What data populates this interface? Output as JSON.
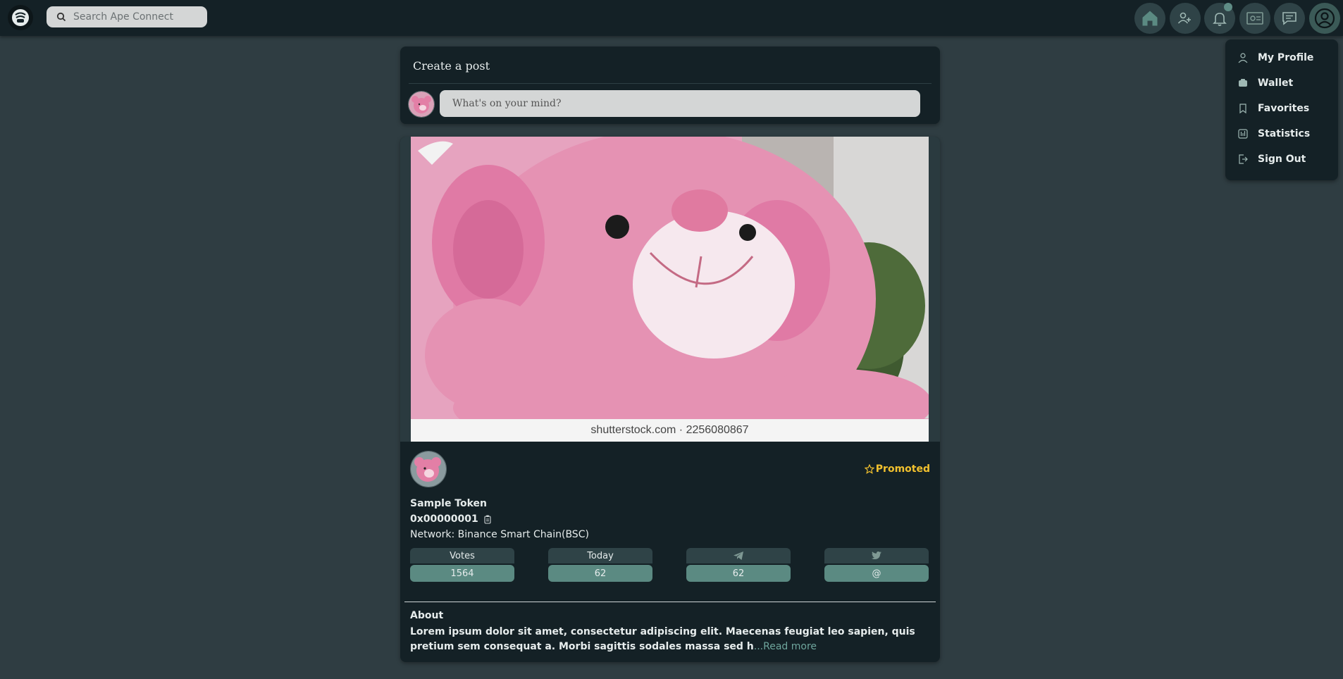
{
  "header": {
    "search_placeholder": "Search Ape Connect",
    "nav": [
      {
        "name": "home-icon"
      },
      {
        "name": "friends-icon"
      },
      {
        "name": "bell-icon"
      },
      {
        "name": "card-icon"
      },
      {
        "name": "chat-icon"
      },
      {
        "name": "profile-icon"
      }
    ]
  },
  "dropdown": {
    "items": [
      {
        "label": "My Profile",
        "icon": "user-icon"
      },
      {
        "label": "Wallet",
        "icon": "wallet-icon"
      },
      {
        "label": "Favorites",
        "icon": "bookmark-icon"
      },
      {
        "label": "Statistics",
        "icon": "statistics-icon"
      },
      {
        "label": "Sign Out",
        "icon": "sign-out-icon"
      }
    ]
  },
  "create_post": {
    "title": "Create a post",
    "placeholder": "What's on your mind?"
  },
  "token": {
    "image_caption": "shutterstock.com · 2256080867",
    "promoted_label": "Promoted",
    "name": "Sample Token",
    "address": "0x00000001",
    "network": "Network: Binance Smart Chain(BSC)",
    "stats": [
      {
        "label": "Votes",
        "value": "1564"
      },
      {
        "label": "Today",
        "value": "62"
      },
      {
        "label": "",
        "icon": "telegram-icon",
        "value": "62"
      },
      {
        "label": "",
        "icon": "twitter-icon",
        "value": "@"
      }
    ],
    "about_title": "About",
    "about_text": "Lorem ipsum dolor sit amet, consectetur adipiscing elit. Maecenas feugiat leo sapien, quis pretium sem consequat a. Morbi sagittis sodales massa sed h",
    "read_more": "...Read more"
  },
  "colors": {
    "background": "#2f3d42",
    "card": "#142126",
    "accent": "#5b8a82",
    "promoted": "#f2c12e"
  }
}
